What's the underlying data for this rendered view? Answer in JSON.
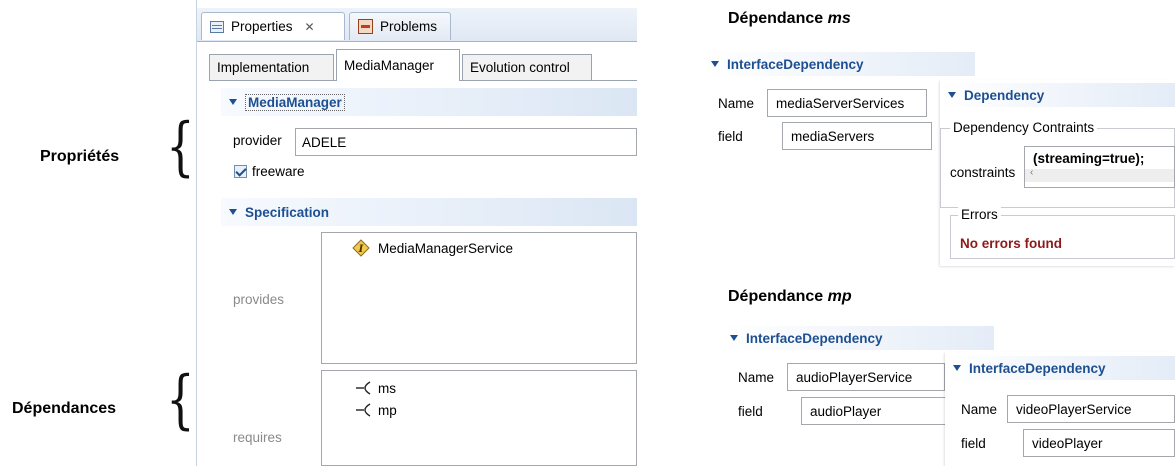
{
  "annotations": {
    "proprietes": "Propriétés",
    "dependances": "Dépendances",
    "dep_ms_prefix": "Dépendance ",
    "dep_ms_name": "ms",
    "dep_mp_prefix": "Dépendance ",
    "dep_mp_name": "mp"
  },
  "view_tabs": [
    {
      "label": "Properties",
      "icon": "properties-view-icon",
      "close": "✕",
      "active": true
    },
    {
      "label": "Problems",
      "icon": "problems-view-icon",
      "active": false
    }
  ],
  "editor_tabs": [
    {
      "label": "Implementation",
      "active": false
    },
    {
      "label": "MediaManager",
      "active": true
    },
    {
      "label": "Evolution control",
      "active": false
    }
  ],
  "mediamanager_section": {
    "title": "MediaManager",
    "provider_label": "provider",
    "provider_value": "ADELE",
    "freeware_label": "freeware",
    "freeware_checked": true
  },
  "specification_section": {
    "title": "Specification",
    "provides_label": "provides",
    "provides_items": [
      {
        "label": "MediaManagerService",
        "icon": "interface-icon"
      }
    ],
    "requires_label": "requires",
    "requires_items": [
      {
        "label": "ms",
        "icon": "required-interface-icon"
      },
      {
        "label": "mp",
        "icon": "required-interface-icon"
      }
    ]
  },
  "dep_ms": {
    "section_title": "InterfaceDependency",
    "name_label": "Name",
    "name_value": "mediaServerServices",
    "field_label": "field",
    "field_value": "mediaServers",
    "dependency": {
      "section_title": "Dependency",
      "contraints_label": "Dependency Contraints",
      "constraints_label": "constraints",
      "constraints_value": "(streaming=true);",
      "errors_label": "Errors",
      "errors_value": "No errors found"
    }
  },
  "dep_mp": {
    "section_title": "InterfaceDependency",
    "name_label": "Name",
    "name_value": "audioPlayerService",
    "field_label": "field",
    "field_value": "audioPlayer",
    "second": {
      "section_title": "InterfaceDependency",
      "name_label": "Name",
      "name_value": "videoPlayerService",
      "field_label": "field",
      "field_value": "videoPlayer"
    }
  },
  "colors": {
    "section_title": "#1d4f91",
    "error_text": "#8b1a1a",
    "tab_strip": "#dfe8f4"
  }
}
